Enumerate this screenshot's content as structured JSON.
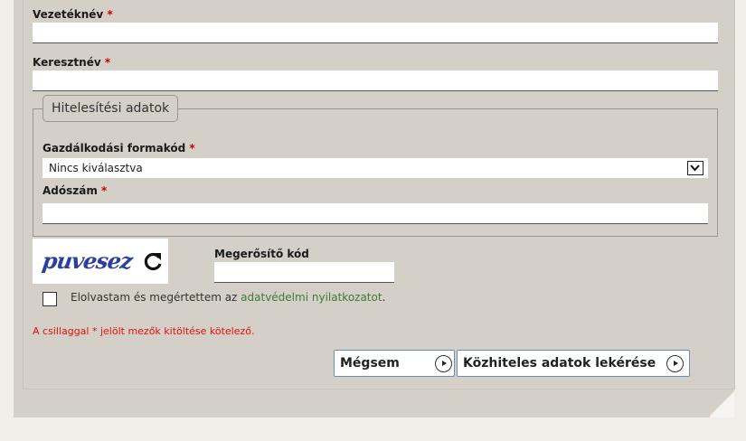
{
  "form": {
    "required_marker": "*",
    "last_name": {
      "label": "Vezetéknév",
      "value": ""
    },
    "first_name": {
      "label": "Keresztnév",
      "value": ""
    },
    "auth_section": {
      "legend": "Hitelesítési adatok",
      "business_form_code": {
        "label": "Gazdálkodási formakód",
        "selected": "Nincs kiválasztva"
      },
      "tax_number": {
        "label": "Adószám",
        "value": ""
      }
    },
    "captcha": {
      "text": "puvesez",
      "code_label": "Megerősítő kód",
      "code_value": ""
    },
    "consent": {
      "before": "Elolvastam és megértettem az ",
      "link": "adatvédelmi nyilatkozatot",
      "after": ".",
      "checked": false
    },
    "required_note": "A csillaggal * jelölt mezők kitöltése kötelező."
  },
  "buttons": {
    "cancel": "Mégsem",
    "submit": "Közhiteles adatok lekérése"
  },
  "colors": {
    "panel": "#d4d0c8",
    "required": "#cc0000",
    "note": "#e01010",
    "link": "#3e7a3e",
    "captcha": "#2b3fa0",
    "button_border": "#6b8db5"
  },
  "icons": {
    "refresh": "refresh-icon",
    "select_arrow": "chevron-down-icon",
    "button_arrow": "arrow-right-circle-icon"
  }
}
